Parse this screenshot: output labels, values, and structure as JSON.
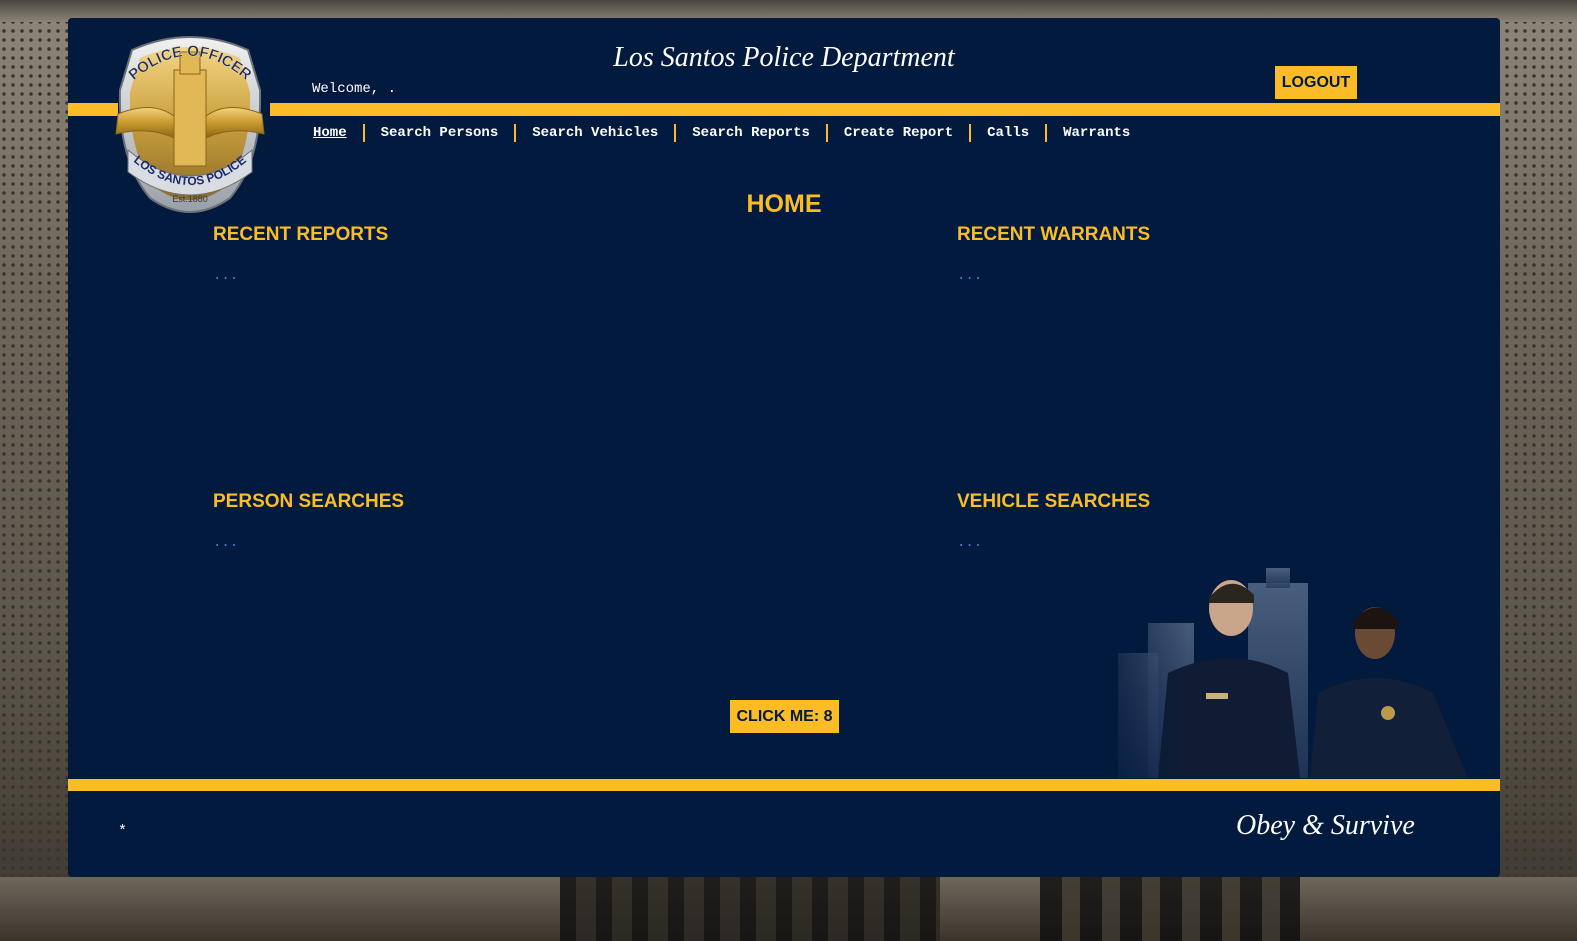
{
  "colors": {
    "panel_bg": "#021a3d",
    "accent_gold": "#fbbc25",
    "link_blue": "#2a8fd6",
    "text_white": "#ffffff"
  },
  "header": {
    "department_title": "Los Santos Police Department",
    "welcome_text": "Welcome, .",
    "logout_label": "LOGOUT",
    "badge": {
      "icon": "police-badge-icon",
      "top_text": "POLICE OFFICER",
      "bottom_text": "LOS SANTOS POLICE",
      "est_text": "Est.1880"
    }
  },
  "nav": {
    "items": [
      {
        "label": "Home",
        "active": true
      },
      {
        "label": "Search Persons"
      },
      {
        "label": "Search Vehicles"
      },
      {
        "label": "Search Reports"
      },
      {
        "label": "Create Report"
      },
      {
        "label": "Calls"
      },
      {
        "label": "Warrants"
      }
    ]
  },
  "main": {
    "page_heading": "HOME",
    "sections": {
      "recent_reports": {
        "title": "RECENT REPORTS",
        "body": "..."
      },
      "recent_warrants": {
        "title": "RECENT WARRANTS",
        "body": "..."
      },
      "person_searches": {
        "title": "PERSON SEARCHES",
        "body": "..."
      },
      "vehicle_searches": {
        "title": "VEHICLE SEARCHES",
        "body": "..."
      }
    },
    "click_button_label": "CLICK ME: 8"
  },
  "footer": {
    "star": "*",
    "motto": "Obey & Survive"
  }
}
